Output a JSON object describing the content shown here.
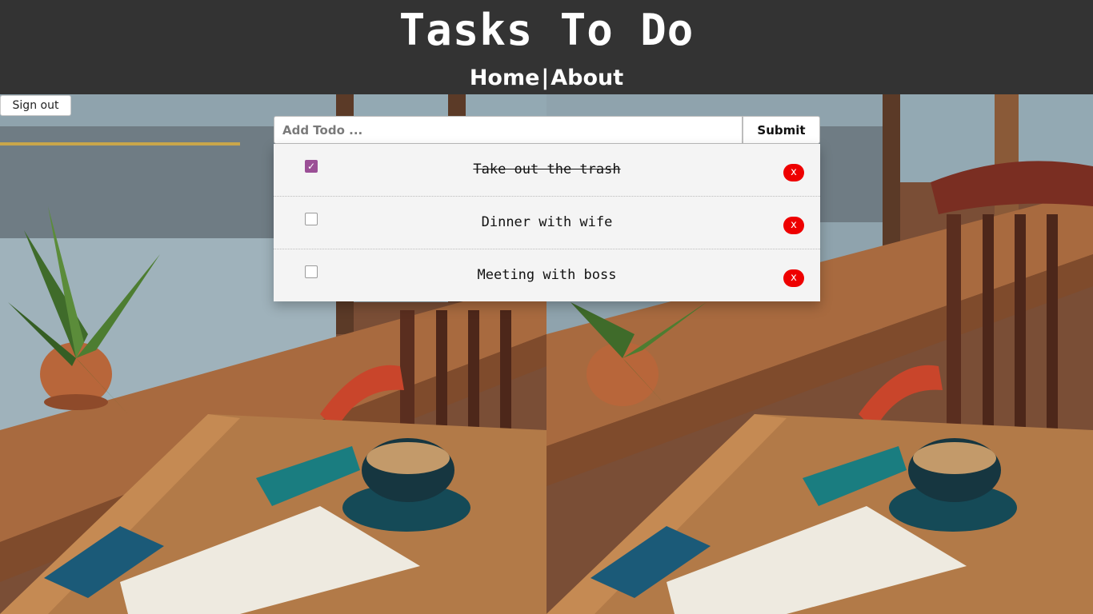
{
  "header": {
    "title": "Tasks To Do",
    "nav": {
      "home_label": "Home",
      "separator": "|",
      "about_label": "About"
    }
  },
  "auth": {
    "signout_label": "Sign out"
  },
  "form": {
    "placeholder": "Add Todo ...",
    "value": "",
    "submit_label": "Submit"
  },
  "todos": [
    {
      "title": "Take out the trash",
      "completed": true,
      "delete_label": "x"
    },
    {
      "title": "Dinner with wife",
      "completed": false,
      "delete_label": "x"
    },
    {
      "title": "Meeting with boss",
      "completed": false,
      "delete_label": "x"
    }
  ],
  "colors": {
    "header_bg": "#333333",
    "check_accent": "#9b4f96",
    "delete_bg": "#ee0000",
    "list_bg": "#f4f4f4"
  },
  "icons": {
    "checkbox_checked": "check-icon"
  }
}
